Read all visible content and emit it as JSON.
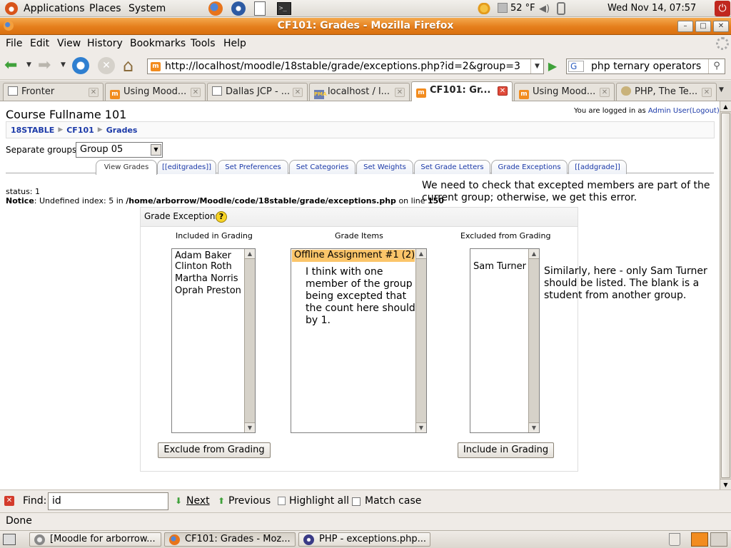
{
  "top_panel": {
    "applications": "Applications",
    "places": "Places",
    "system": "System",
    "weather": "52 °F",
    "clock": "Wed Nov 14, 07:57"
  },
  "window": {
    "title": "CF101: Grades - Mozilla Firefox"
  },
  "menu": {
    "file": "File",
    "edit": "Edit",
    "view": "View",
    "history": "History",
    "bookmarks": "Bookmarks",
    "tools": "Tools",
    "help": "Help"
  },
  "nav": {
    "url": "http://localhost/moodle/18stable/grade/exceptions.php?id=2&group=3",
    "search_engine": "G",
    "search_text": "php ternary operators"
  },
  "tabs": [
    {
      "label": "Fronter"
    },
    {
      "label": "Using Mood..."
    },
    {
      "label": "Dallas JCP - ..."
    },
    {
      "label": "localhost / l..."
    },
    {
      "label": "CF101: Gr..."
    },
    {
      "label": "Using Mood..."
    },
    {
      "label": "PHP, The Te..."
    }
  ],
  "page": {
    "course_title": "Course Fullname 101",
    "login_prefix": "You are logged in as",
    "login_user": "Admin User",
    "logout": "(Logout)",
    "breadcrumb": [
      "18STABLE",
      "CF101",
      "Grades"
    ],
    "separate_groups_label": "Separate groups",
    "group_selected": "Group 05",
    "moodle_tabs": [
      "View Grades",
      "[[editgrades]]",
      "Set Preferences",
      "Set Categories",
      "Set Weights",
      "Set Grade Letters",
      "Grade Exceptions",
      "[[addgrade]]"
    ],
    "status": "status: 1",
    "notice_label": "Notice",
    "notice_text": ": Undefined index: 5 in",
    "notice_path": "/home/arborrow/Moodle/code/18stable/grade/exceptions.php",
    "notice_online": "on line",
    "notice_line": "150",
    "panel_title": "Grade Exceptions",
    "col_included": "Included in Grading",
    "col_items": "Grade Items",
    "col_excluded": "Excluded from Grading",
    "included": [
      "Adam Baker",
      "Clinton Roth",
      "Martha Norris",
      "Oprah Preston"
    ],
    "grade_item_selected": "Offline Assignment #1 (2)",
    "excluded": [
      "",
      "Sam Turner"
    ],
    "exclude_button": "Exclude from Grading",
    "include_button": "Include in Grading"
  },
  "annotations": {
    "note1": "We need to check that excepted members are part of the current group; otherwise, we get this error.",
    "note2": "I think with one member of the group being excepted that the count here should by 1.",
    "note3": "Similarly, here - only Sam Turner should be listed. The blank is a student from another group."
  },
  "find": {
    "label": "Find:",
    "value": "id",
    "next": "Next",
    "previous": "Previous",
    "highlight": "Highlight all",
    "match_case": "Match case"
  },
  "status_bar": {
    "text": "Done"
  },
  "taskbar": [
    {
      "label": "[Moodle for arborrow..."
    },
    {
      "label": "CF101: Grades - Moz..."
    },
    {
      "label": "PHP - exceptions.php..."
    }
  ],
  "colors": {
    "titlebar": "#e57e1c",
    "link": "#1c3aa8",
    "selected_item": "#fbc56a"
  }
}
